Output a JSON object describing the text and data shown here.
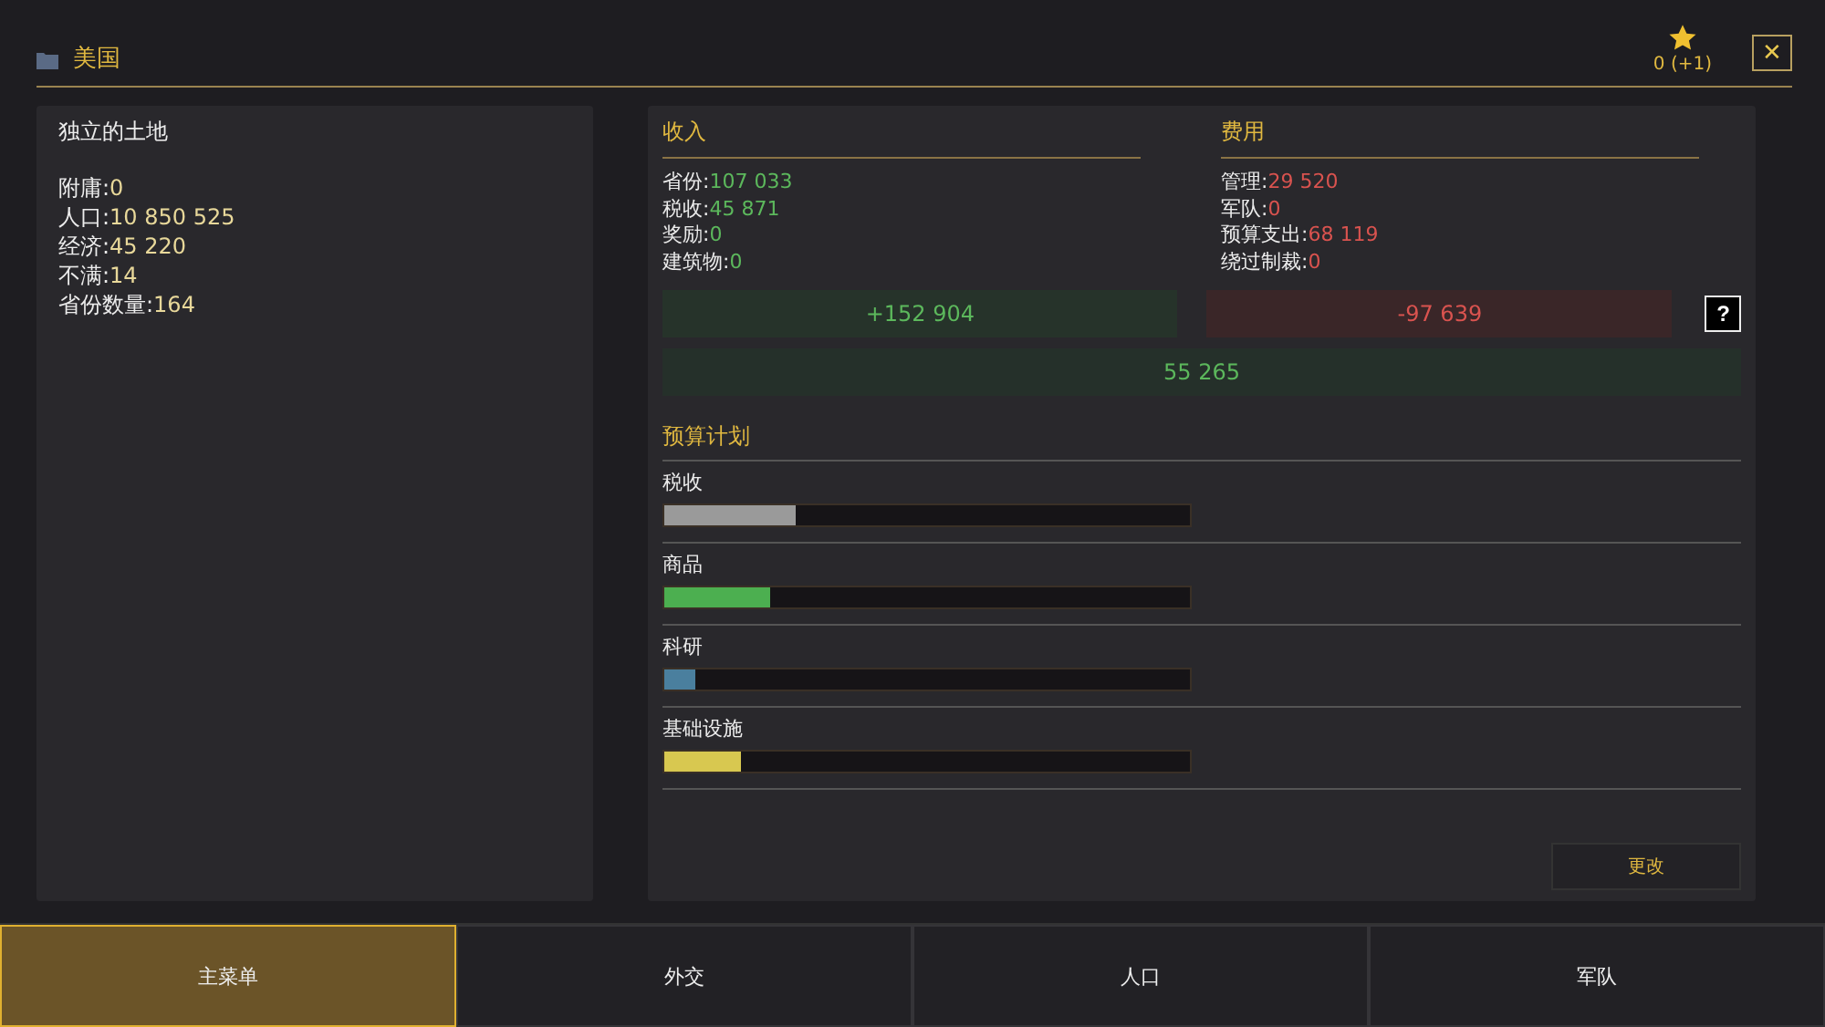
{
  "header": {
    "title": "美国",
    "score": "0 (+1)",
    "close": "✕"
  },
  "overview": {
    "title": "独立的土地",
    "stats": [
      {
        "label": "附庸:",
        "value": "0"
      },
      {
        "label": "人口:",
        "value": "10 850 525"
      },
      {
        "label": "经济:",
        "value": "45 220"
      },
      {
        "label": "不满:",
        "value": "14"
      },
      {
        "label": "省份数量:",
        "value": "164"
      }
    ]
  },
  "income": {
    "title": "收入",
    "items": [
      {
        "label": "省份:",
        "value": "107 033"
      },
      {
        "label": "税收:",
        "value": "45 871"
      },
      {
        "label": "奖励:",
        "value": "0"
      },
      {
        "label": "建筑物:",
        "value": "0"
      }
    ],
    "total": "+152 904"
  },
  "expenses": {
    "title": "费用",
    "items": [
      {
        "label": "管理:",
        "value": "29 520"
      },
      {
        "label": "军队:",
        "value": "0"
      },
      {
        "label": "预算支出:",
        "value": "68 119"
      },
      {
        "label": "绕过制裁:",
        "value": "0"
      }
    ],
    "total": "-97 639"
  },
  "help": "?",
  "balance": "55 265",
  "budget": {
    "title": "预算计划",
    "items": [
      {
        "label": "税收",
        "level": 0.25,
        "color": "#9a9a9a"
      },
      {
        "label": "商品",
        "level": 0.2,
        "color": "#4caf50"
      },
      {
        "label": "科研",
        "level": 0.06,
        "color": "#4a7f9e"
      },
      {
        "label": "基础设施",
        "level": 0.145,
        "color": "#d8c850"
      }
    ],
    "button": "更改"
  },
  "tabs": [
    {
      "label": "主菜单",
      "selected": true
    },
    {
      "label": "外交",
      "selected": false
    },
    {
      "label": "人口",
      "selected": false
    },
    {
      "label": "军队",
      "selected": false
    }
  ]
}
